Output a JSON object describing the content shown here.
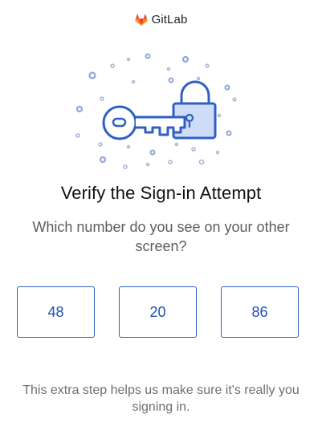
{
  "brand": {
    "name": "GitLab",
    "logo_icon": "gitlab-tanuki-logo",
    "logo_color": "#fc6d26"
  },
  "illustration": {
    "icon": "key-and-padlock-illustration",
    "accent_color": "#2f5fc4",
    "fill_color": "#cfdcf7"
  },
  "title": "Verify the Sign-in Attempt",
  "prompt": "Which number do you see on your other screen?",
  "choices": [
    "48",
    "20",
    "86"
  ],
  "footnote": "This extra step helps us make sure it's really you signing in.",
  "colors": {
    "button_border": "#2f5fc4",
    "button_text": "#1f4fb8"
  }
}
